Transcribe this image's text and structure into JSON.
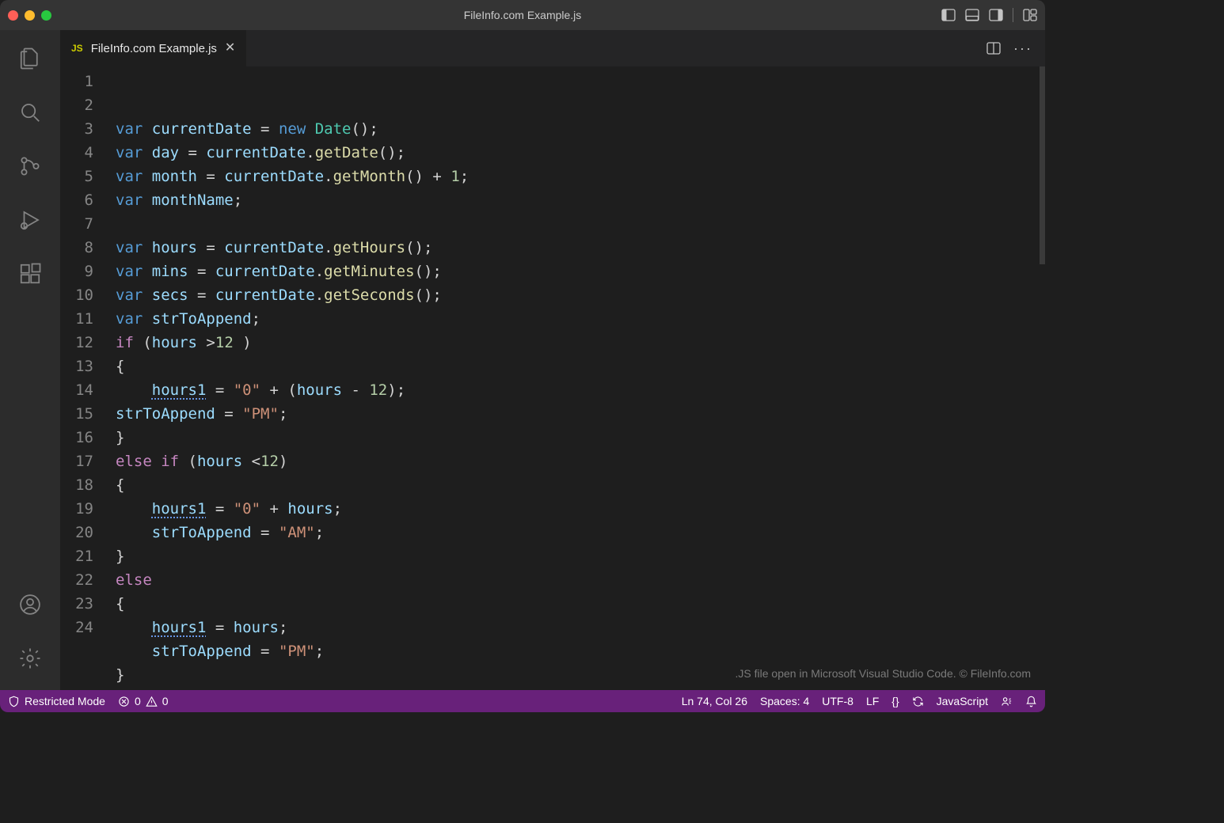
{
  "titlebar": {
    "title": "FileInfo.com Example.js"
  },
  "tab": {
    "badge": "JS",
    "filename": "FileInfo.com Example.js"
  },
  "gutter": {
    "start": 1,
    "end": 24
  },
  "code_lines": [
    [
      [
        "kw",
        "var "
      ],
      [
        "id",
        "currentDate"
      ],
      [
        "op",
        " = "
      ],
      [
        "kw",
        "new "
      ],
      [
        "type",
        "Date"
      ],
      [
        "pun",
        "();"
      ]
    ],
    [
      [
        "kw",
        "var "
      ],
      [
        "id",
        "day"
      ],
      [
        "op",
        " = "
      ],
      [
        "id",
        "currentDate"
      ],
      [
        "pun",
        "."
      ],
      [
        "fn",
        "getDate"
      ],
      [
        "pun",
        "();"
      ]
    ],
    [
      [
        "kw",
        "var "
      ],
      [
        "id",
        "month"
      ],
      [
        "op",
        " = "
      ],
      [
        "id",
        "currentDate"
      ],
      [
        "pun",
        "."
      ],
      [
        "fn",
        "getMonth"
      ],
      [
        "pun",
        "() + "
      ],
      [
        "num",
        "1"
      ],
      [
        "pun",
        ";"
      ]
    ],
    [
      [
        "kw",
        "var "
      ],
      [
        "id",
        "monthName"
      ],
      [
        "pun",
        ";"
      ]
    ],
    [],
    [
      [
        "kw",
        "var "
      ],
      [
        "id",
        "hours"
      ],
      [
        "op",
        " = "
      ],
      [
        "id",
        "currentDate"
      ],
      [
        "pun",
        "."
      ],
      [
        "fn",
        "getHours"
      ],
      [
        "pun",
        "();"
      ]
    ],
    [
      [
        "kw",
        "var "
      ],
      [
        "id",
        "mins"
      ],
      [
        "op",
        " = "
      ],
      [
        "id",
        "currentDate"
      ],
      [
        "pun",
        "."
      ],
      [
        "fn",
        "getMinutes"
      ],
      [
        "pun",
        "();"
      ]
    ],
    [
      [
        "kw",
        "var "
      ],
      [
        "id",
        "secs"
      ],
      [
        "op",
        " = "
      ],
      [
        "id",
        "currentDate"
      ],
      [
        "pun",
        "."
      ],
      [
        "fn",
        "getSeconds"
      ],
      [
        "pun",
        "();"
      ]
    ],
    [
      [
        "kw",
        "var "
      ],
      [
        "id",
        "strToAppend"
      ],
      [
        "pun",
        ";"
      ]
    ],
    [
      [
        "kwc",
        "if "
      ],
      [
        "pun",
        "("
      ],
      [
        "id",
        "hours"
      ],
      [
        "op",
        " >"
      ],
      [
        "num",
        "12 "
      ],
      [
        "pun",
        ")"
      ]
    ],
    [
      [
        "pun",
        "{"
      ]
    ],
    [
      [
        "pun",
        "    "
      ],
      [
        "id wavy",
        "hours1"
      ],
      [
        "op",
        " = "
      ],
      [
        "str",
        "\"0\""
      ],
      [
        "op",
        " + ("
      ],
      [
        "id",
        "hours"
      ],
      [
        "op",
        " - "
      ],
      [
        "num",
        "12"
      ],
      [
        "pun",
        ");"
      ]
    ],
    [
      [
        "id",
        "strToAppend"
      ],
      [
        "op",
        " = "
      ],
      [
        "str",
        "\"PM\""
      ],
      [
        "pun",
        ";"
      ]
    ],
    [
      [
        "pun",
        "}"
      ]
    ],
    [
      [
        "kwc",
        "else if "
      ],
      [
        "pun",
        "("
      ],
      [
        "id",
        "hours"
      ],
      [
        "op",
        " <"
      ],
      [
        "num",
        "12"
      ],
      [
        "pun",
        ")"
      ]
    ],
    [
      [
        "pun",
        "{"
      ]
    ],
    [
      [
        "pun",
        "    "
      ],
      [
        "id wavy",
        "hours1"
      ],
      [
        "op",
        " = "
      ],
      [
        "str",
        "\"0\""
      ],
      [
        "op",
        " + "
      ],
      [
        "id",
        "hours"
      ],
      [
        "pun",
        ";"
      ]
    ],
    [
      [
        "pun",
        "    "
      ],
      [
        "id",
        "strToAppend"
      ],
      [
        "op",
        " = "
      ],
      [
        "str",
        "\"AM\""
      ],
      [
        "pun",
        ";"
      ]
    ],
    [
      [
        "pun",
        "}"
      ]
    ],
    [
      [
        "kwc",
        "else"
      ]
    ],
    [
      [
        "pun",
        "{"
      ]
    ],
    [
      [
        "pun",
        "    "
      ],
      [
        "id wavy",
        "hours1"
      ],
      [
        "op",
        " = "
      ],
      [
        "id",
        "hours"
      ],
      [
        "pun",
        ";"
      ]
    ],
    [
      [
        "pun",
        "    "
      ],
      [
        "id",
        "strToAppend"
      ],
      [
        "op",
        " = "
      ],
      [
        "str",
        "\"PM\""
      ],
      [
        "pun",
        ";"
      ]
    ],
    [
      [
        "pun",
        "}"
      ]
    ]
  ],
  "watermark": ".JS file open in Microsoft Visual Studio Code. © FileInfo.com",
  "status": {
    "restricted": "Restricted Mode",
    "errors": "0",
    "warnings": "0",
    "cursor": "Ln 74, Col 26",
    "spaces": "Spaces: 4",
    "encoding": "UTF-8",
    "eol": "LF",
    "braces": "{}",
    "language": "JavaScript"
  }
}
